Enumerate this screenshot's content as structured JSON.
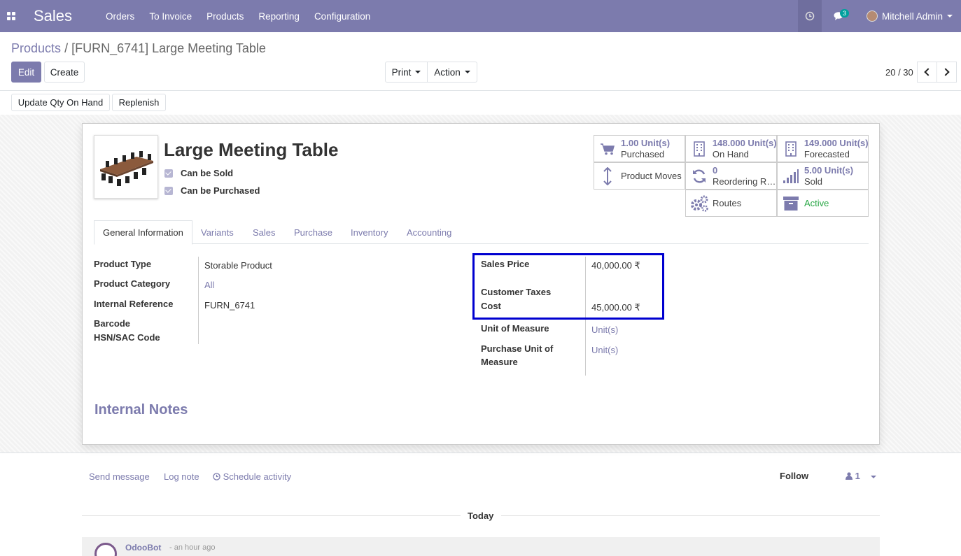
{
  "navbar": {
    "brand": "Sales",
    "menu": [
      "Orders",
      "To Invoice",
      "Products",
      "Reporting",
      "Configuration"
    ],
    "chat_count": "3",
    "user": "Mitchell Admin",
    "color": "#7c7bad"
  },
  "breadcrumb": {
    "parent": "Products",
    "separator": "/",
    "current": "[FURN_6741] Large Meeting Table"
  },
  "toolbar": {
    "edit": "Edit",
    "create": "Create",
    "print": "Print",
    "action": "Action",
    "pager": "20 / 30",
    "update_qty": "Update Qty On Hand",
    "replenish": "Replenish"
  },
  "product": {
    "name": "Large Meeting Table",
    "can_be_sold": "Can be Sold",
    "can_be_purchased": "Can be Purchased"
  },
  "stats": [
    {
      "icon": "cart-icon",
      "value": "1.00 Unit(s)",
      "label": "Purchased"
    },
    {
      "icon": "building-icon",
      "value": "148.000 Unit(s)",
      "label": "On Hand"
    },
    {
      "icon": "building-icon",
      "value": "149.000 Unit(s)",
      "label": "Forecasted"
    },
    {
      "icon": "updown-arrow-icon",
      "value": "",
      "label": "Product Moves"
    },
    {
      "icon": "refresh-icon",
      "value": "0",
      "label": "Reordering R…"
    },
    {
      "icon": "signal-icon",
      "value": "5.00 Unit(s)",
      "label": "Sold"
    },
    {
      "icon": "gears-icon",
      "value": "",
      "label": "Routes"
    },
    {
      "icon": "archive-icon",
      "value": "",
      "label": "Active"
    }
  ],
  "tabs": [
    "General Information",
    "Variants",
    "Sales",
    "Purchase",
    "Inventory",
    "Accounting"
  ],
  "left_fields": {
    "product_type_label": "Product Type",
    "product_type": "Storable Product",
    "category_label": "Product Category",
    "category": "All",
    "internal_ref_label": "Internal Reference",
    "internal_ref": "FURN_6741",
    "barcode_label": "Barcode",
    "hsn_label": "HSN/SAC Code"
  },
  "right_fields": {
    "sales_price_label": "Sales Price",
    "sales_price": "40,000.00 ₹",
    "taxes_label": "Customer Taxes",
    "cost_label": "Cost",
    "cost": "45,000.00 ₹",
    "uom_label": "Unit of Measure",
    "uom": "Unit(s)",
    "purchase_uom_label_1": "Purchase Unit of",
    "purchase_uom_label_2": "Measure",
    "purchase_uom": "Unit(s)"
  },
  "notes_title": "Internal Notes",
  "chatter": {
    "send_message": "Send message",
    "log_note": "Log note",
    "schedule": "Schedule activity",
    "follow": "Follow",
    "followers": "1",
    "today": "Today",
    "author": "OdooBot",
    "time": "- an hour ago"
  }
}
